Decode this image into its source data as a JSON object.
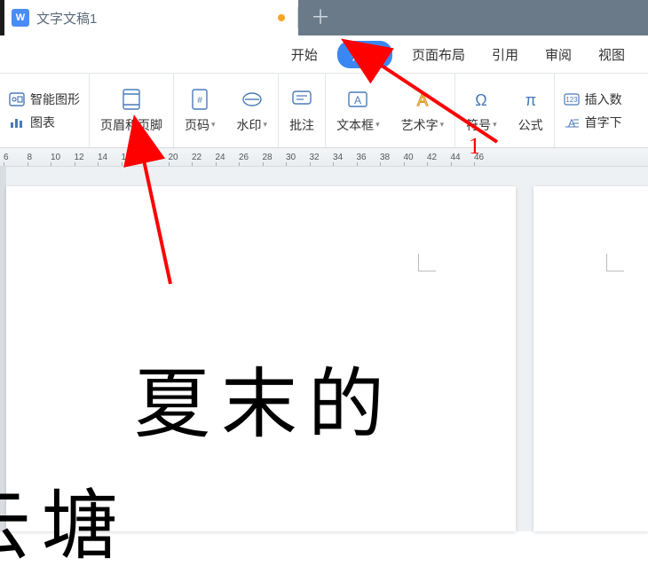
{
  "tab": {
    "icon_letter": "W",
    "title": "文字文稿1"
  },
  "menu": {
    "items": [
      "开始",
      "插入",
      "页面布局",
      "引用",
      "审阅",
      "视图"
    ],
    "active_index": 1
  },
  "ribbon": {
    "left_group": {
      "item1": "智能图形",
      "item2": "图表"
    },
    "big_buttons": {
      "header_footer": "页眉和页脚",
      "page_number": "页码",
      "watermark": "水印",
      "comment": "批注",
      "text_box": "文本框",
      "word_art": "艺术字",
      "symbol": "符号",
      "equation": "公式"
    },
    "right_group": {
      "item1": "插入数",
      "item2": "首字下"
    }
  },
  "ruler": {
    "numbers": [
      "6",
      "8",
      "10",
      "12",
      "14",
      "16",
      "18",
      "20",
      "22",
      "24",
      "26",
      "28",
      "30",
      "32",
      "34",
      "36",
      "38",
      "40",
      "42",
      "44",
      "46"
    ]
  },
  "document": {
    "line1": "夏末的",
    "line2_partial": "云塘",
    "page2_partial": ""
  },
  "annotation": {
    "label": "1"
  }
}
